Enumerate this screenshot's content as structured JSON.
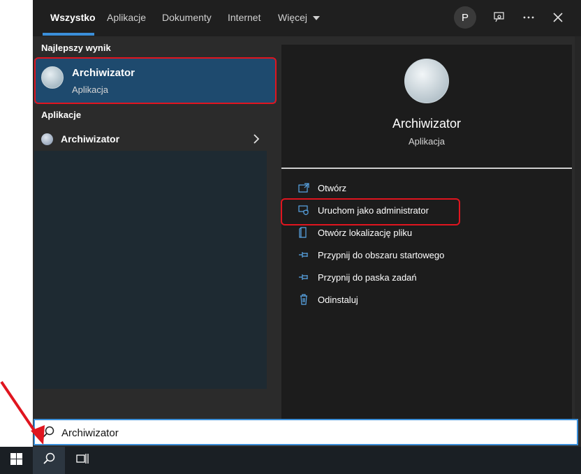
{
  "tabs": [
    {
      "label": "Wszystko"
    },
    {
      "label": "Aplikacje"
    },
    {
      "label": "Dokumenty"
    },
    {
      "label": "Internet"
    },
    {
      "label": "Więcej"
    }
  ],
  "account": {
    "initial": "P"
  },
  "best_match": {
    "section_title": "Najlepszy wynik",
    "title": "Archiwizator",
    "subtitle": "Aplikacja"
  },
  "apps": {
    "section_title": "Aplikacje",
    "items": [
      {
        "label": "Archiwizator"
      }
    ]
  },
  "detail": {
    "title": "Archiwizator",
    "subtitle": "Aplikacja",
    "actions": [
      {
        "label": "Otwórz",
        "icon": "open-icon"
      },
      {
        "label": "Uruchom jako administrator",
        "icon": "shield-icon"
      },
      {
        "label": "Otwórz lokalizację pliku",
        "icon": "folder-icon"
      },
      {
        "label": "Przypnij do obszaru startowego",
        "icon": "pin-icon"
      },
      {
        "label": "Przypnij do paska zadań",
        "icon": "pin-icon"
      },
      {
        "label": "Odinstaluj",
        "icon": "trash-icon"
      }
    ]
  },
  "search": {
    "value": "Archiwizator"
  },
  "colors": {
    "accent": "#3b8fd9",
    "highlight": "#e0151f",
    "selected": "#1e4a6e"
  }
}
